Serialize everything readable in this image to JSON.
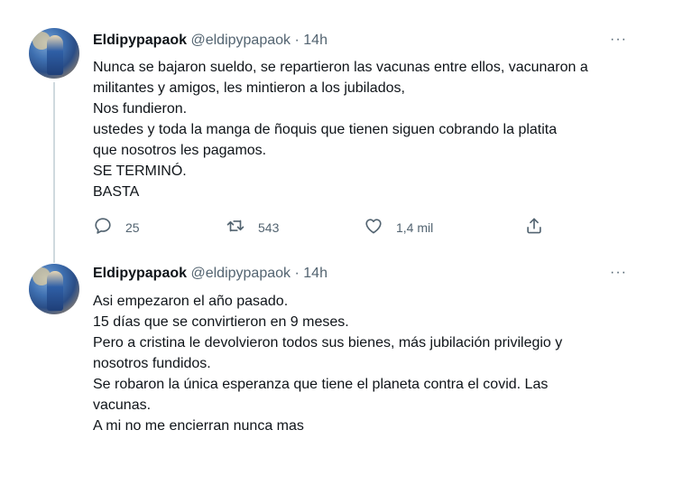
{
  "tweets": [
    {
      "name": "Eldipypapaok",
      "handle": "@eldipypapaok",
      "dot": "·",
      "time": "14h",
      "more": "···",
      "lines": [
        "Nunca se bajaron sueldo, se repartieron las vacunas entre ellos, vacunaron a",
        "militantes y amigos, les mintieron a los jubilados,",
        "Nos fundieron.",
        "ustedes y toda la manga de ñoquis que tienen siguen cobrando la platita",
        "que nosotros les pagamos.",
        "SE TERMINÓ.",
        "BASTA"
      ],
      "replies": "25",
      "retweets": "543",
      "likes": "1,4 mil",
      "icons": {
        "reply": "reply-icon",
        "retweet": "retweet-icon",
        "like": "like-icon",
        "share": "share-icon"
      }
    },
    {
      "name": "Eldipypapaok",
      "handle": "@eldipypapaok",
      "dot": "·",
      "time": "14h",
      "more": "···",
      "lines": [
        "Asi empezaron el año pasado.",
        "15 días que se convirtieron en 9 meses.",
        "Pero a cristina le devolvieron todos sus bienes, más jubilación privilegio y",
        "nosotros fundidos.",
        "Se robaron la única esperanza que tiene el planeta contra el covid. Las",
        "vacunas.",
        "A mi no me encierran nunca mas"
      ]
    }
  ],
  "colors": {
    "text": "#0f1419",
    "secondary": "#536471",
    "thread": "#cfd9de"
  }
}
